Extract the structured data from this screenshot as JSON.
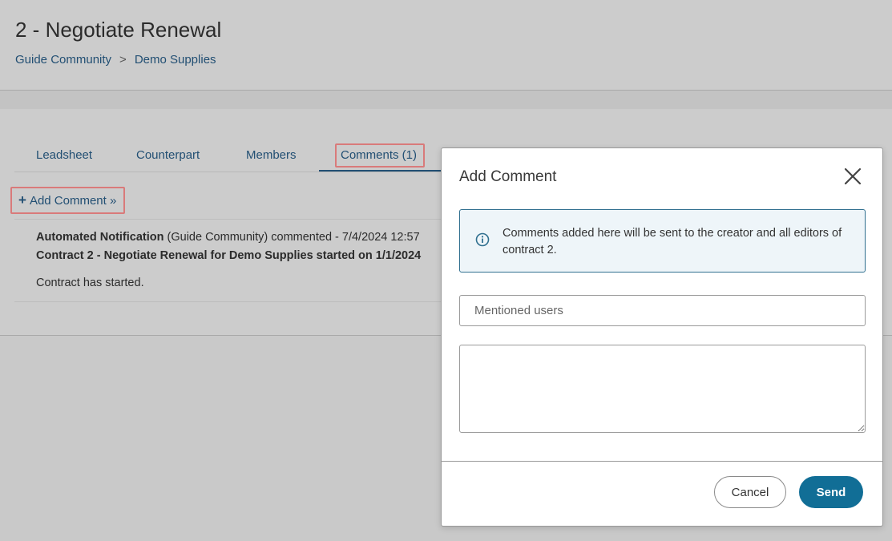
{
  "page": {
    "title": "2 - Negotiate Renewal",
    "breadcrumb": {
      "items": [
        "Guide Community",
        "Demo Supplies"
      ],
      "separator": ">"
    }
  },
  "tabs": [
    {
      "label": "Leadsheet"
    },
    {
      "label": "Counterpart"
    },
    {
      "label": "Members"
    },
    {
      "label": "Comments (1)",
      "active": true
    }
  ],
  "add_comment": {
    "icon": "plus-icon",
    "label": "Add Comment »"
  },
  "comment": {
    "author": "Automated Notification",
    "meta": " (Guide Community) commented - 7/4/2024 12:57",
    "subject": "Contract 2 - Negotiate Renewal for Demo Supplies started on 1/1/2024",
    "body": "Contract has started."
  },
  "modal": {
    "title": "Add Comment",
    "close_icon": "close-icon",
    "info_icon": "info-circle-icon",
    "info_text": "Comments added here will be sent to the creator and all editors of contract 2.",
    "mention_placeholder": "Mentioned users",
    "comment_value": "",
    "cancel_label": "Cancel",
    "send_label": "Send"
  },
  "colors": {
    "link": "#224f73",
    "highlight": "#d97a7a",
    "primary_button": "#116e96",
    "info_border": "#2f6f8f",
    "info_bg": "#eef5f9"
  }
}
